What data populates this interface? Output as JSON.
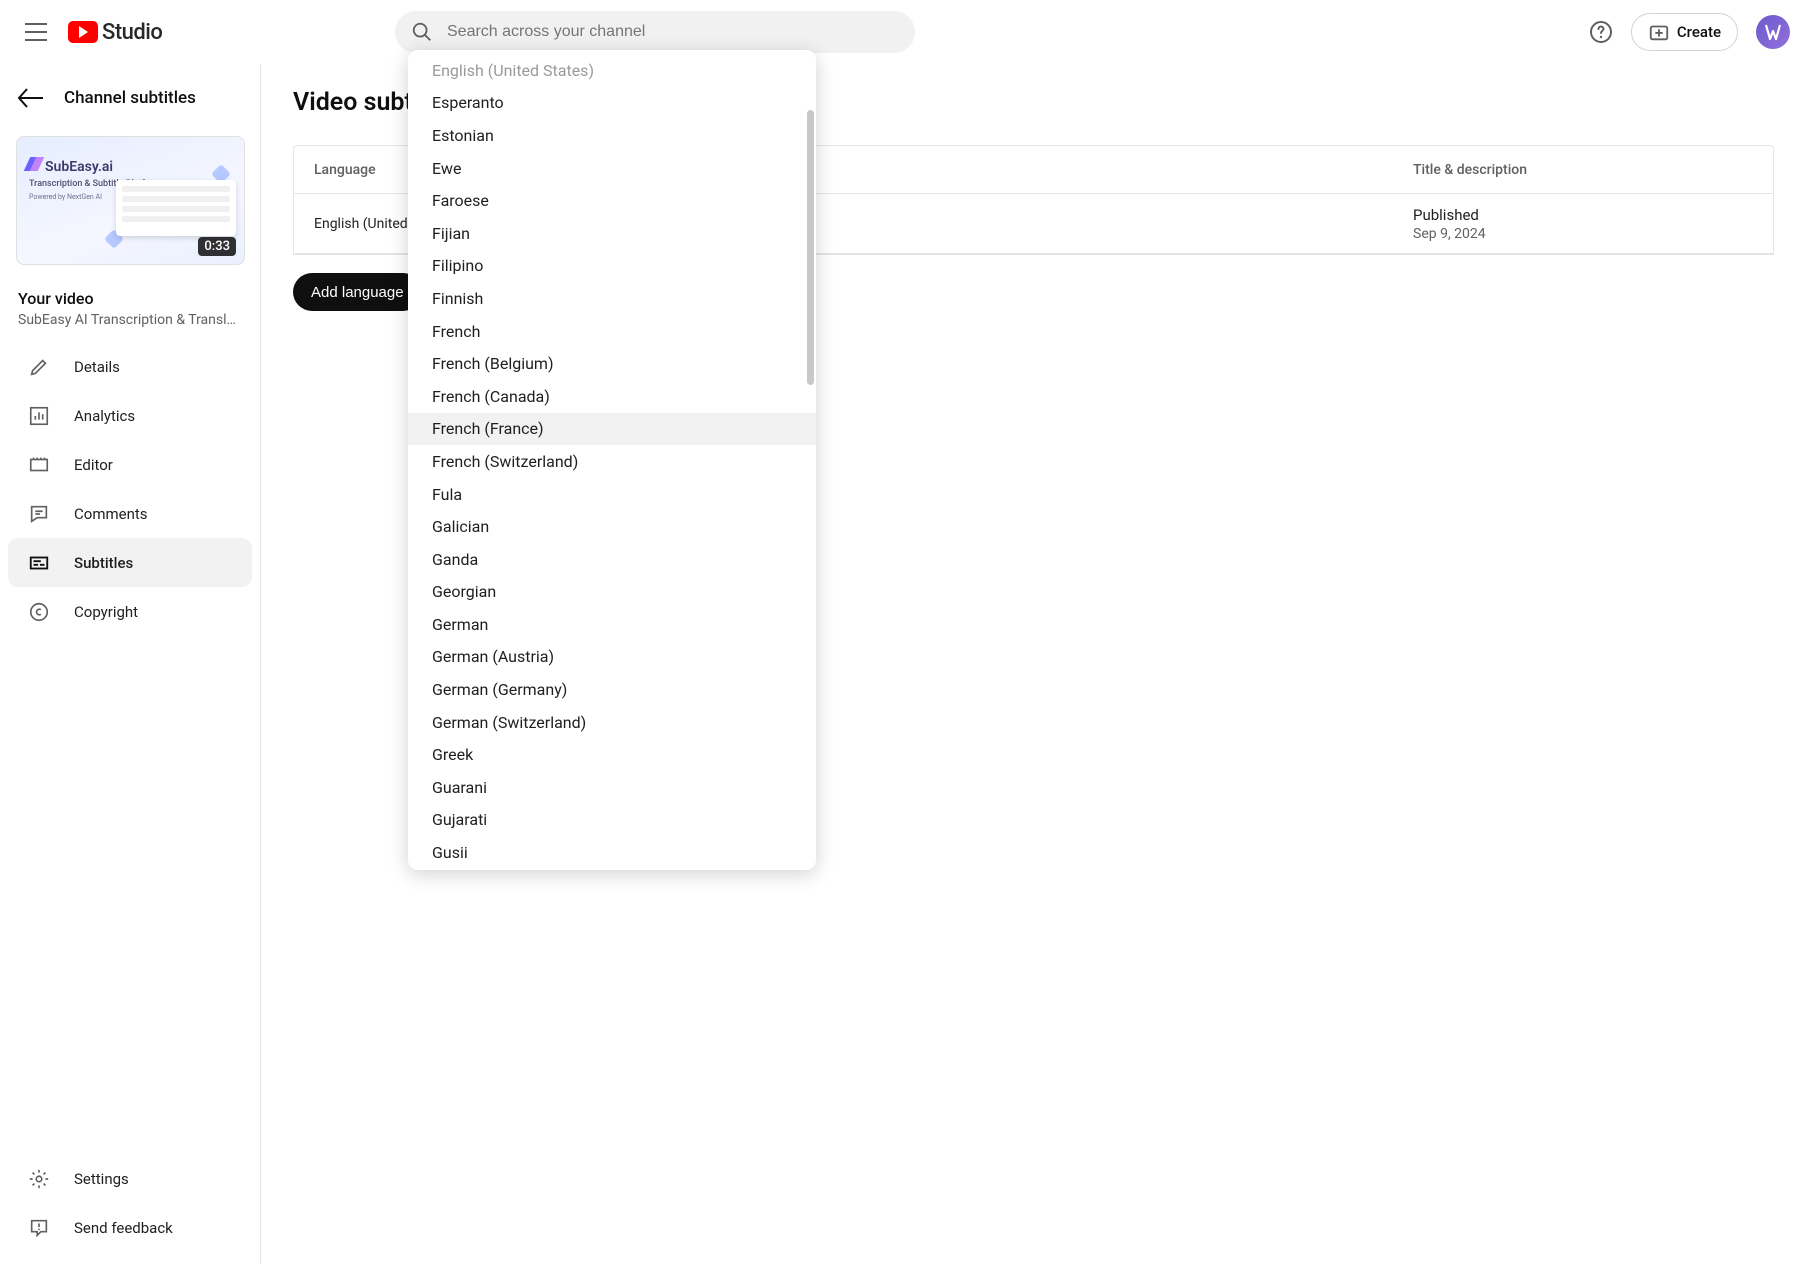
{
  "header": {
    "logo_text": "Studio",
    "search_placeholder": "Search across your channel",
    "create_label": "Create"
  },
  "sidebar": {
    "back_title": "Channel subtitles",
    "duration_badge": "0:33",
    "thumb_brand": "SubEasy.ai",
    "thumb_line1": "Transcription & Subtitle Platform",
    "thumb_line2": "Powered by NextGen AI",
    "your_video_label": "Your video",
    "video_title": "SubEasy AI Transcription & Translati…",
    "nav": [
      {
        "key": "details",
        "label": "Details"
      },
      {
        "key": "analytics",
        "label": "Analytics"
      },
      {
        "key": "editor",
        "label": "Editor"
      },
      {
        "key": "comments",
        "label": "Comments"
      },
      {
        "key": "subtitles",
        "label": "Subtitles"
      },
      {
        "key": "copyright",
        "label": "Copyright"
      }
    ],
    "bottom": [
      {
        "key": "settings",
        "label": "Settings"
      },
      {
        "key": "feedback",
        "label": "Send feedback"
      }
    ]
  },
  "main": {
    "page_title": "Video subtitles",
    "columns": {
      "language": "Language",
      "title_desc": "Title & description"
    },
    "row": {
      "language": "English (United States)",
      "status": "Published",
      "date": "Sep 9, 2024"
    },
    "add_language_label": "Add language"
  },
  "dropdown": {
    "items": [
      {
        "label": "English (United States)",
        "faded": true
      },
      {
        "label": "Esperanto"
      },
      {
        "label": "Estonian"
      },
      {
        "label": "Ewe"
      },
      {
        "label": "Faroese"
      },
      {
        "label": "Fijian"
      },
      {
        "label": "Filipino"
      },
      {
        "label": "Finnish"
      },
      {
        "label": "French"
      },
      {
        "label": "French (Belgium)"
      },
      {
        "label": "French (Canada)"
      },
      {
        "label": "French (France)",
        "hover": true
      },
      {
        "label": "French (Switzerland)"
      },
      {
        "label": "Fula"
      },
      {
        "label": "Galician"
      },
      {
        "label": "Ganda"
      },
      {
        "label": "Georgian"
      },
      {
        "label": "German"
      },
      {
        "label": "German (Austria)"
      },
      {
        "label": "German (Germany)"
      },
      {
        "label": "German (Switzerland)"
      },
      {
        "label": "Greek"
      },
      {
        "label": "Guarani"
      },
      {
        "label": "Gujarati"
      },
      {
        "label": "Gusii"
      }
    ]
  }
}
